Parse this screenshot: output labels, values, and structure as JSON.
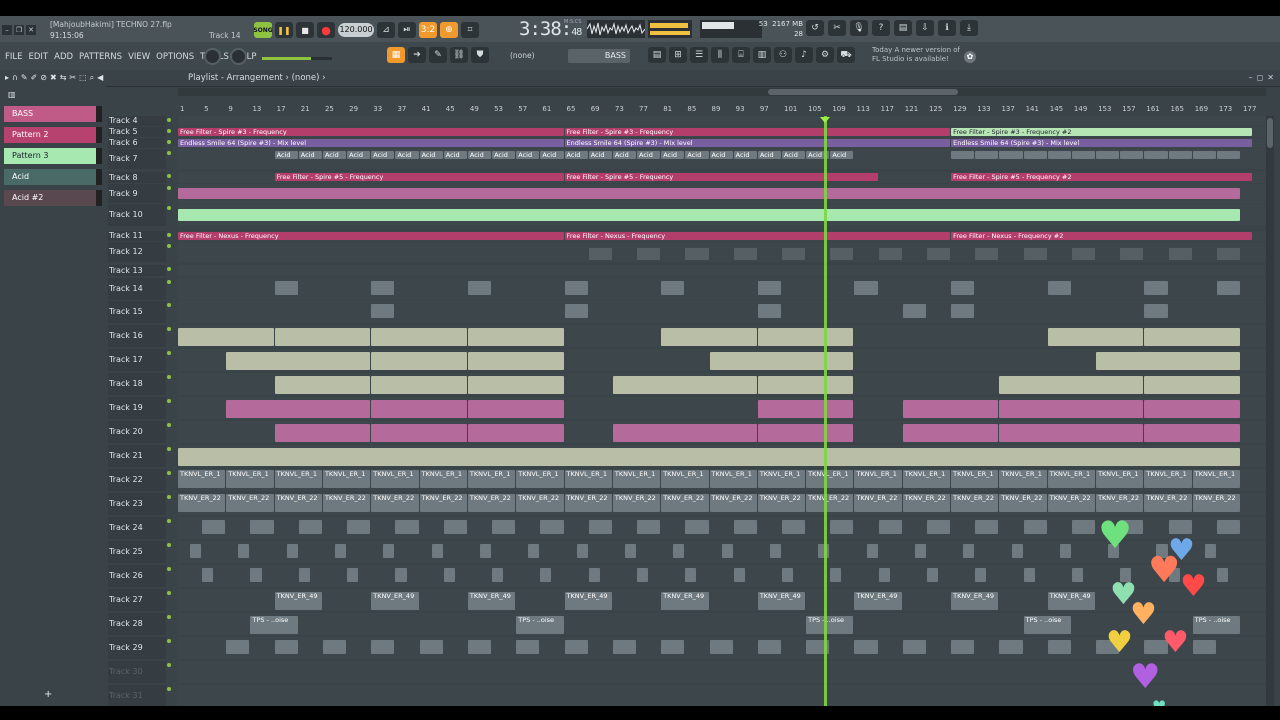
{
  "window": {
    "project_title": "[MahjoubHakimi] TECHNO 27.flp",
    "project_time": "91:15:06",
    "hint_target": "Track 14"
  },
  "transport": {
    "mode_label": "SONG",
    "tempo": "120.000",
    "time_main": "3:38",
    "time_sub": "48",
    "time_unit": "M:S:CS",
    "cpu": "53",
    "memory": "2167 MB",
    "polyphony": "28",
    "pattern_counter": "3:2"
  },
  "menu": [
    "FILE",
    "EDIT",
    "ADD",
    "PATTERNS",
    "VIEW",
    "OPTIONS",
    "TOOLS",
    "HELP"
  ],
  "pattern_selector": "(none)",
  "channel_selector": "BASS",
  "notice": {
    "line1": "Today  A newer version of",
    "line2": "FL Studio is available!"
  },
  "playlist": {
    "title": "Playlist - Arrangement",
    "pattern": "(none)",
    "playhead_bar": 108
  },
  "patterns": [
    {
      "label": "BASS",
      "color": "#c05a86"
    },
    {
      "label": "Pattern 2",
      "color": "#b8426f"
    },
    {
      "label": "Pattern 3",
      "color": "#a6e8b0"
    },
    {
      "label": "Acid",
      "color": "#4a6a68"
    },
    {
      "label": "Acid #2",
      "color": "#5a4850"
    }
  ],
  "ruler": {
    "start": 1,
    "step": 4,
    "end": 177
  },
  "tracks": [
    {
      "name": "Track 4",
      "dim": false
    },
    {
      "name": "Track 5",
      "dim": false
    },
    {
      "name": "Track 6",
      "dim": false
    },
    {
      "name": "Track 7",
      "dim": false
    },
    {
      "name": "Track 8",
      "dim": false
    },
    {
      "name": "Track 9",
      "dim": false
    },
    {
      "name": "Track 10",
      "dim": false
    },
    {
      "name": "Track 11",
      "dim": false
    },
    {
      "name": "Track 12",
      "dim": false
    },
    {
      "name": "Track 13",
      "dim": false
    },
    {
      "name": "Track 14",
      "dim": false
    },
    {
      "name": "Track 15",
      "dim": false
    },
    {
      "name": "Track 16",
      "dim": false
    },
    {
      "name": "Track 17",
      "dim": false
    },
    {
      "name": "Track 18",
      "dim": false
    },
    {
      "name": "Track 19",
      "dim": false
    },
    {
      "name": "Track 20",
      "dim": false
    },
    {
      "name": "Track 21",
      "dim": false
    },
    {
      "name": "Track 22",
      "dim": false
    },
    {
      "name": "Track 23",
      "dim": false
    },
    {
      "name": "Track 24",
      "dim": false
    },
    {
      "name": "Track 25",
      "dim": false
    },
    {
      "name": "Track 26",
      "dim": false
    },
    {
      "name": "Track 27",
      "dim": false
    },
    {
      "name": "Track 28",
      "dim": false
    },
    {
      "name": "Track 29",
      "dim": false
    },
    {
      "name": "Track 30",
      "dim": true
    },
    {
      "name": "Track 31",
      "dim": true
    }
  ],
  "clips": {
    "free_filter_spire3": "Free Filter - Spire #3 - Frequency",
    "free_filter_spire3_2": "Free Filter - Spire #3 - Frequency #2",
    "endless_smile": "Endless Smile 64 (Spire #3) - Mix level",
    "free_filter_spire5": "Free Filter - Spire #5 - Frequency",
    "free_filter_spire5_2": "Free Filter - Spire #5 - Frequency #2",
    "free_filter_nexus": "Free Filter - Nexus - Frequency",
    "free_filter_nexus_2": "Free Filter - Nexus - Frequency #2",
    "acid": "Acid",
    "tknvl": "TKNVL_ER_1",
    "tknv": "TKNV_ER_22",
    "tknv49": "TKNV_ER_49",
    "tps": "TPS - ..oise"
  }
}
